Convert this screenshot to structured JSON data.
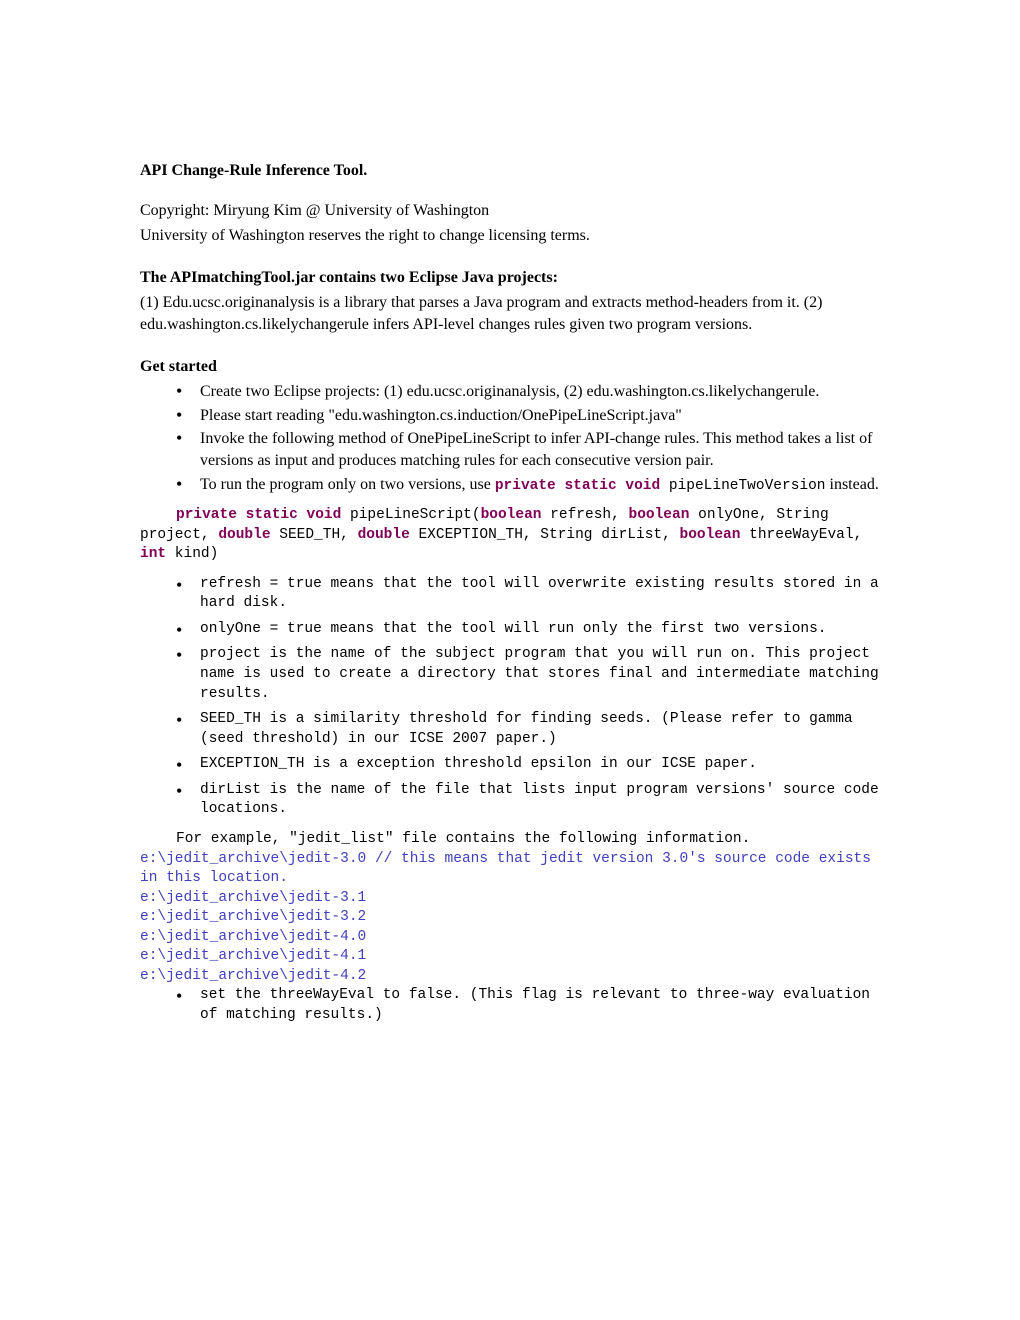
{
  "title": "API Change-Rule Inference Tool.",
  "copyright_line1": "Copyright: Miryung Kim @ University of Washington",
  "copyright_line2": "University of Washington reserves the right to change licensing terms.",
  "section_jar_heading": "The APImatchingTool.jar contains two Eclipse Java projects:",
  "section_jar_body": "(1) Edu.ucsc.originanalysis is a library that parses a Java program and extracts method-headers from it. (2) edu.washington.cs.likelychangerule infers API-level changes rules given two program versions.",
  "get_started_heading": "Get started",
  "get_started_items": [
    "Create two Eclipse projects: (1) edu.ucsc.originanalysis, (2) edu.washington.cs.likelychangerule.",
    "Please start reading \"edu.washington.cs.induction/OnePipeLineScript.java\"",
    "Invoke the following method of OnePipeLineScript to infer API-change rules. This method takes a list of versions as input and produces matching rules for each consecutive version pair."
  ],
  "get_started_item4_prefix": "To run the program only on two versions, use ",
  "get_started_item4_kw": "private static void",
  "get_started_item4_mono": " pipeLineTwoVersion",
  "get_started_item4_suffix": " instead.",
  "sig": {
    "kw1": "private static void",
    "t1": " pipeLineScript(",
    "kw2": "boolean",
    "t2": " refresh, ",
    "kw3": "boolean",
    "t3": " onlyOne, String project, ",
    "kw4": "double",
    "t4": " SEED_TH, ",
    "kw5": "double",
    "t5": " EXCEPTION_TH, String dirList, ",
    "kw6": "boolean",
    "t6": " threeWayEval, ",
    "kw7": "int",
    "t7": " kind)"
  },
  "param_items": [
    "refresh = true means that the tool will overwrite existing results stored in a hard disk.",
    "onlyOne = true means that the tool will run only the first two versions.",
    "project is the name of the subject program that you will run on. This project name is used to create a directory that stores final and intermediate matching results.",
    "SEED_TH is a similarity threshold for finding seeds. (Please refer to gamma (seed threshold) in our ICSE 2007 paper.)",
    "EXCEPTION_TH is a exception threshold epsilon in our ICSE paper.",
    "dirList is the name of the file that lists input program versions' source code locations."
  ],
  "example_intro": "For example, \"jedit_list\" file contains the following information.",
  "example_lines": [
    "e:\\jedit_archive\\jedit-3.0 // this means that jedit version 3.0's source code exists in this location.",
    "e:\\jedit_archive\\jedit-3.1",
    "e:\\jedit_archive\\jedit-3.2",
    "e:\\jedit_archive\\jedit-4.0",
    "e:\\jedit_archive\\jedit-4.1",
    "e:\\jedit_archive\\jedit-4.2"
  ],
  "final_bullet": "set the threeWayEval to false. (This flag is relevant to three-way evaluation of matching results.)"
}
